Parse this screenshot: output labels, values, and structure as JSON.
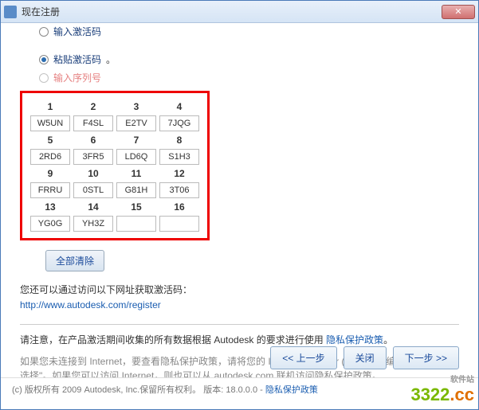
{
  "window": {
    "title": "现在注册",
    "close_glyph": "✕"
  },
  "options": {
    "opt1_label": "输入激活码",
    "opt2_label": "粘贴激活码",
    "opt3_label": "输入序列号",
    "period": "。"
  },
  "grid": {
    "headers_a": [
      "1",
      "2",
      "3",
      "4"
    ],
    "row_a": [
      "W5UN",
      "F4SL",
      "E2TV",
      "7JQG"
    ],
    "headers_b": [
      "5",
      "6",
      "7",
      "8"
    ],
    "row_b": [
      "2RD6",
      "3FR5",
      "LD6Q",
      "S1H3"
    ],
    "headers_c": [
      "9",
      "10",
      "11",
      "12"
    ],
    "row_c": [
      "FRRU",
      "0STL",
      "G81H",
      "3T06"
    ],
    "headers_d": [
      "13",
      "14",
      "15",
      "16"
    ],
    "row_d": [
      "YG0G",
      "YH3Z",
      "",
      ""
    ]
  },
  "buttons": {
    "clear_all": "全部清除",
    "prev": "<< 上一步",
    "close": "关闭",
    "next": "下一步 >>"
  },
  "info": {
    "line1": "您还可以通过访问以下网址获取激活码：",
    "url": "http://www.autodesk.com/register"
  },
  "note": {
    "prefix": "请注意，在产品激活期间收集的所有数据根据 Autodesk 的要求进行使用 ",
    "policy_link": "隐私保护政策",
    "suffix": "。"
  },
  "gray": {
    "line1": "如果您未连接到 Internet，要查看隐私保护政策，请将您的 Internet Explorer (R) 浏览器编码设置为\"自动选择\"。如果您可以访问 Internet，则也可以从 autodesk.com 联机访问隐私保护政策。"
  },
  "footer": {
    "copyright": "(c) 版权所有 2009 Autodesk, Inc.保留所有权利。  版本: 18.0.0.0 - ",
    "policy_link": "隐私保护政策"
  },
  "watermark": {
    "brand1": "3322",
    "brand2": ".cc",
    "sub": "软件站"
  }
}
